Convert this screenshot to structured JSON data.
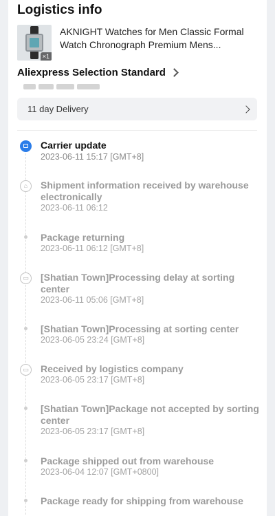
{
  "header": {
    "title": "Logistics info"
  },
  "product": {
    "name": "AKNIGHT Watches for Men Classic Formal Watch Chronograph Premium Mens...",
    "quantity": "×1",
    "thumbnail_icon": "watch-image"
  },
  "selection": {
    "label": "Aliexpress Selection Standard"
  },
  "delivery": {
    "label": "11 day Delivery"
  },
  "colors": {
    "accent": "#2b7de9",
    "active_title": "#111111",
    "inactive_title": "#9b9b9b"
  },
  "events": [
    {
      "title": "Carrier update",
      "time": "2023-06-11 15:17 [GMT+8]",
      "icon": "document-icon",
      "active": true
    },
    {
      "title": "Shipment information received by warehouse electronically",
      "time": "2023-06-11 06:12",
      "icon": "warehouse-icon",
      "active": false
    },
    {
      "title": "Package returning",
      "time": "2023-06-11 06:12 [GMT+8]",
      "icon": "dot",
      "active": false
    },
    {
      "title": "[Shatian Town]Processing delay at sorting center",
      "time": "2023-06-11 05:06 [GMT+8]",
      "icon": "truck-icon",
      "active": false
    },
    {
      "title": "[Shatian Town]Processing at sorting center",
      "time": "2023-06-05 23:24 [GMT+8]",
      "icon": "dot",
      "active": false
    },
    {
      "title": "Received by logistics company",
      "time": "2023-06-05 23:17 [GMT+8]",
      "icon": "truck-icon",
      "active": false
    },
    {
      "title": "[Shatian Town]Package not accepted by sorting center",
      "time": "2023-06-05 23:17 [GMT+8]",
      "icon": "dot",
      "active": false
    },
    {
      "title": "Package shipped out from warehouse",
      "time": "2023-06-04 12:07 [GMT+0800]",
      "icon": "dot",
      "active": false
    },
    {
      "title": "Package ready for shipping from warehouse",
      "time": "",
      "icon": "dot",
      "active": false
    }
  ]
}
